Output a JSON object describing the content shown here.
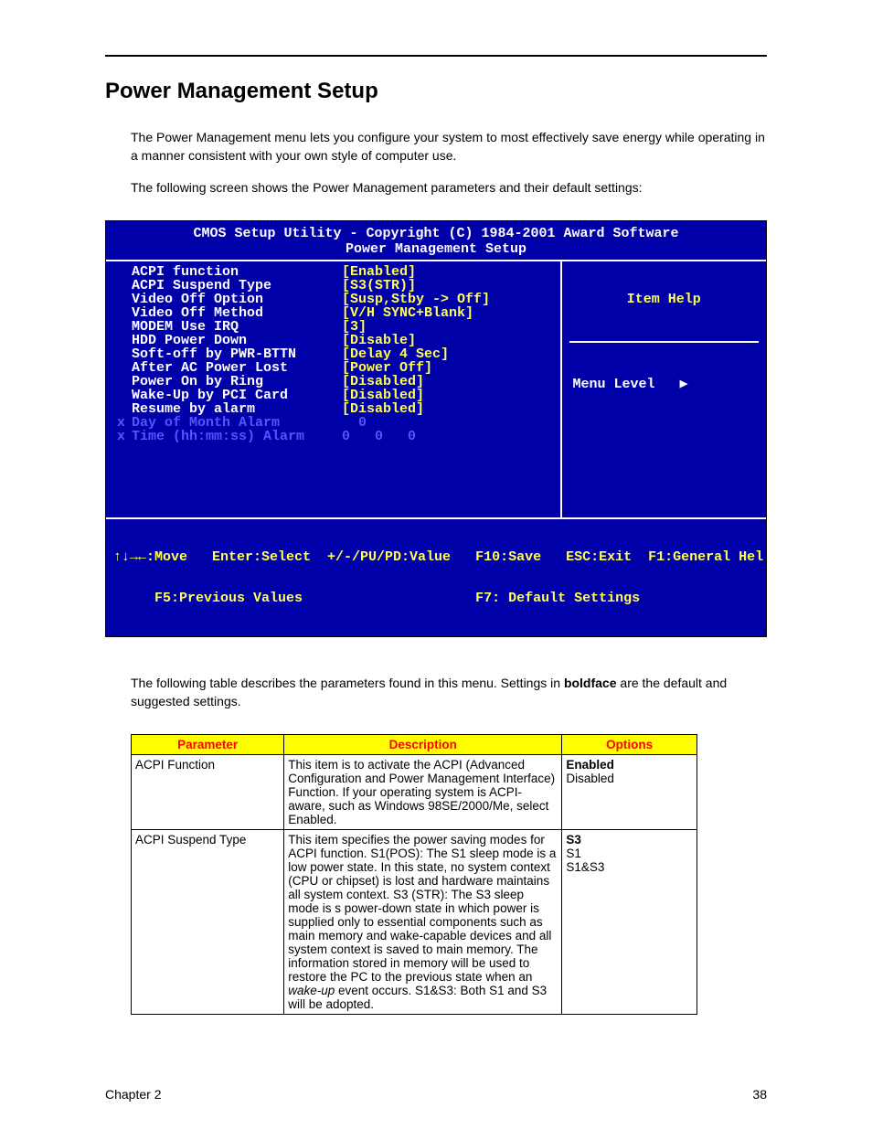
{
  "heading": "Power Management Setup",
  "intro1": "The Power Management menu lets you configure your system to most effectively save energy while operating in a manner consistent with your own style of computer use.",
  "intro2": "The following screen shows the Power Management parameters and their default settings:",
  "bios": {
    "title": "CMOS Setup Utility - Copyright (C) 1984-2001 Award Software",
    "subtitle": "Power Management Setup",
    "rows": [
      {
        "x": false,
        "label": "ACPI function",
        "value": "[Enabled]"
      },
      {
        "x": false,
        "label": "ACPI Suspend Type",
        "value": "[S3(STR)]"
      },
      {
        "x": false,
        "label": "Video Off Option",
        "value": "[Susp,Stby -> Off]"
      },
      {
        "x": false,
        "label": "Video Off Method",
        "value": "[V/H SYNC+Blank]"
      },
      {
        "x": false,
        "label": "MODEM Use IRQ",
        "value": "[3]"
      },
      {
        "x": false,
        "label": "HDD Power Down",
        "value": "[Disable]"
      },
      {
        "x": false,
        "label": "Soft-off by PWR-BTTN",
        "value": "[Delay 4 Sec]"
      },
      {
        "x": false,
        "label": "After AC Power Lost",
        "value": "[Power Off]"
      },
      {
        "x": false,
        "label": "Power On by Ring",
        "value": "[Disabled]"
      },
      {
        "x": false,
        "label": "Wake-Up by PCI Card",
        "value": "[Disabled]"
      },
      {
        "x": false,
        "label": "Resume by alarm",
        "value": "[Disabled]"
      },
      {
        "x": true,
        "label": "Day of Month Alarm",
        "value": "  0"
      },
      {
        "x": true,
        "label": "Time (hh:mm:ss) Alarm",
        "value": "0   0   0"
      }
    ],
    "help_title": "Item Help",
    "menu_level": "Menu Level   ▶",
    "bottom1": "↑↓→←:Move   Enter:Select  +/-/PU/PD:Value   F10:Save   ESC:Exit  F1:General Hel",
    "bottom2": "     F5:Previous Values                     F7: Default Settings"
  },
  "table_intro_pre": "The following table describes the parameters found in this menu.  Settings in ",
  "table_intro_bold": "boldface",
  "table_intro_post": " are the default and suggested settings.",
  "table": {
    "headers": {
      "p": "Parameter",
      "d": "Description",
      "o": "Options"
    },
    "rows": [
      {
        "param": "ACPI Function",
        "desc": "This item is to activate the ACPI (Advanced Configuration and Power Management Interface) Function.  If your operating system is ACPI-aware, such as Windows 98SE/2000/Me, select Enabled.",
        "opts": [
          {
            "t": "Enabled",
            "b": true
          },
          {
            "t": "Disabled",
            "b": false
          }
        ]
      },
      {
        "param": "ACPI Suspend Type",
        "desc_pre": "This item specifies the power saving modes for ACPI function.  S1(POS): The S1 sleep mode is a low power state. In this state, no system context (CPU or chipset) is lost and hardware maintains all system context.  S3 (STR): The S3 sleep mode is s power-down state in which power is supplied only to essential components such as main memory and wake-capable devices and all system context is saved to main memory.  The information stored in memory will be used to restore the PC to the previous state when an ",
        "desc_italic": "wake-up",
        "desc_post": " event occurs.  S1&S3: Both S1 and S3 will be adopted.",
        "opts": [
          {
            "t": "S3",
            "b": true
          },
          {
            "t": "S1",
            "b": false
          },
          {
            "t": "S1&S3",
            "b": false
          }
        ]
      }
    ]
  },
  "footer": {
    "left": "Chapter 2",
    "right": "38"
  }
}
